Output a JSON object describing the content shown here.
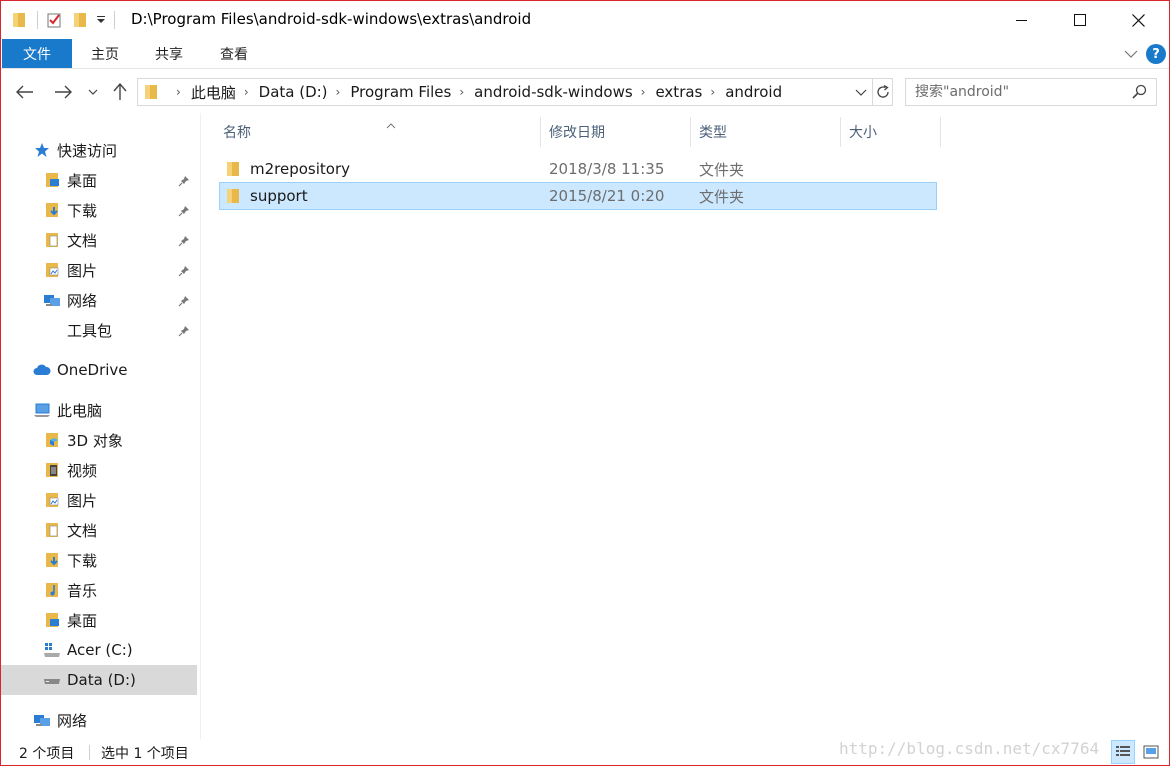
{
  "title_bar": {
    "path": "D:\\Program Files\\android-sdk-windows\\extras\\android"
  },
  "ribbon": {
    "tabs": [
      "文件",
      "主页",
      "共享",
      "查看"
    ]
  },
  "address": {
    "crumbs": [
      "此电脑",
      "Data (D:)",
      "Program Files",
      "android-sdk-windows",
      "extras",
      "android"
    ]
  },
  "search": {
    "placeholder": "搜索\"android\""
  },
  "nav": {
    "quick_access": "快速访问",
    "quick_items": [
      "桌面",
      "下载",
      "文档",
      "图片",
      "网络",
      "工具包"
    ],
    "onedrive": "OneDrive",
    "this_pc": "此电脑",
    "pc_items": [
      "3D 对象",
      "视频",
      "图片",
      "文档",
      "下载",
      "音乐",
      "桌面",
      "Acer (C:)",
      "Data (D:)"
    ],
    "network": "网络"
  },
  "columns": {
    "name": "名称",
    "date": "修改日期",
    "type": "类型",
    "size": "大小"
  },
  "files": [
    {
      "name": "m2repository",
      "date": "2018/3/8 11:35",
      "type": "文件夹"
    },
    {
      "name": "support",
      "date": "2015/8/21 0:20",
      "type": "文件夹"
    }
  ],
  "status": {
    "count": "2 个项目",
    "selected": "选中 1 个项目"
  },
  "watermark": "http://blog.csdn.net/cx7764",
  "colors": {
    "accent": "#1979ca",
    "selection": "#cce8ff",
    "folder": "#e8b94a",
    "window_border": "#d9262e"
  }
}
